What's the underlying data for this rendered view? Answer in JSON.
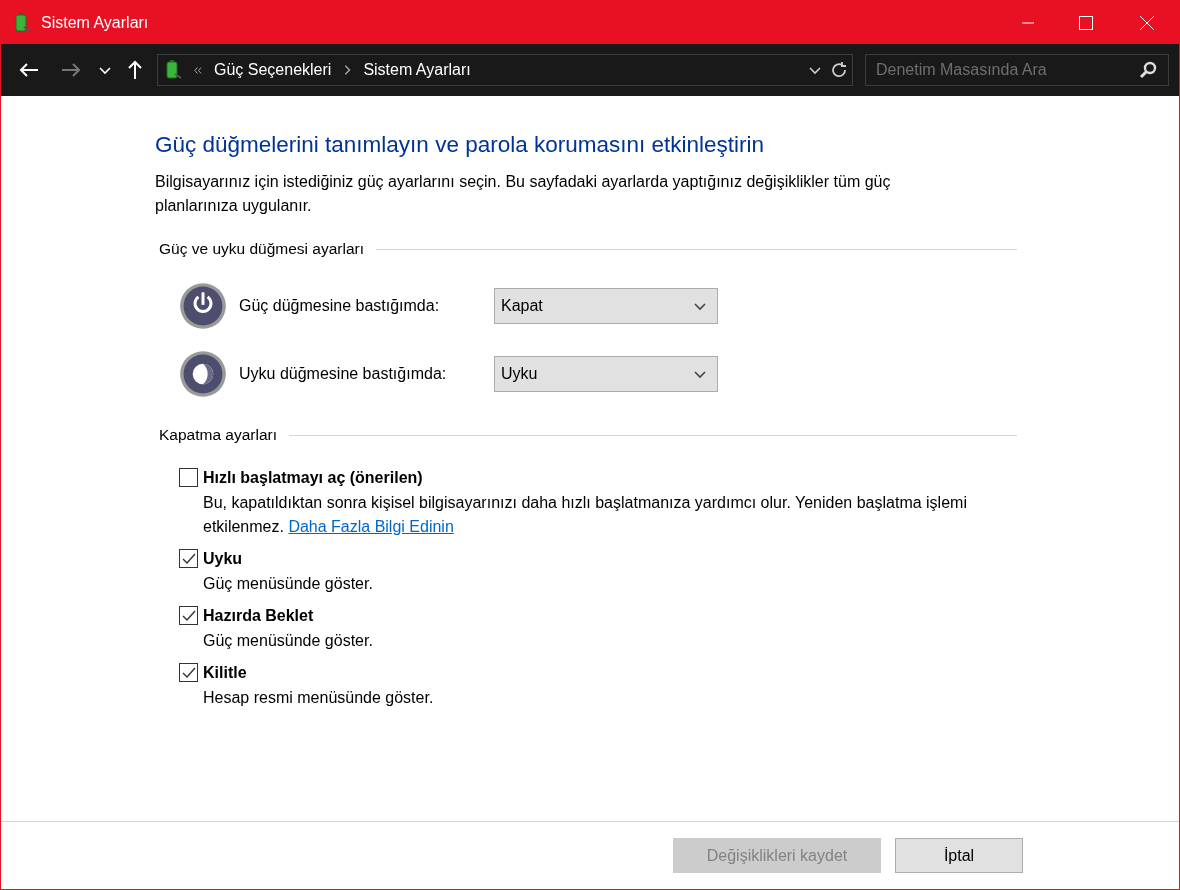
{
  "window": {
    "title": "Sistem Ayarları"
  },
  "navigation": {
    "forward_disabled": true,
    "breadcrumb": [
      "Güç Seçenekleri",
      "Sistem Ayarları"
    ],
    "search": {
      "placeholder": "Denetim Masasında Ara"
    }
  },
  "heading": "Güç düğmelerini tanımlayın ve parola korumasını etkinleştirin",
  "intro": "Bilgisayarınız için istediğiniz güç ayarlarını seçin. Bu sayfadaki ayarlarda yaptığınız değişiklikler tüm güç planlarınıza uygulanır.",
  "button_section": {
    "title": "Güç ve uyku düğmesi ayarları",
    "rows": [
      {
        "kind": "power",
        "label": "Güç düğmesine bastığımda:",
        "value": "Kapat"
      },
      {
        "kind": "sleep",
        "label": "Uyku düğmesine bastığımda:",
        "value": "Uyku"
      }
    ]
  },
  "shutdown_section": {
    "title": "Kapatma ayarları",
    "options": [
      {
        "label": "Hızlı başlatmayı aç (önerilen)",
        "checked": false,
        "description": "Bu, kapatıldıktan sonra kişisel bilgisayarınızı daha hızlı başlatmanıza yardımcı olur. Yeniden başlatma işlemi etkilenmez.",
        "link": "Daha Fazla Bilgi Edinin"
      },
      {
        "label": "Uyku",
        "checked": true,
        "description": "Güç menüsünde göster."
      },
      {
        "label": "Hazırda Beklet",
        "checked": true,
        "description": "Güç menüsünde göster."
      },
      {
        "label": "Kilitle",
        "checked": true,
        "description": "Hesap resmi menüsünde göster."
      }
    ]
  },
  "buttons": [
    {
      "label": "Değişiklikleri kaydet",
      "disabled": true
    },
    {
      "label": "İptal",
      "disabled": false
    }
  ]
}
